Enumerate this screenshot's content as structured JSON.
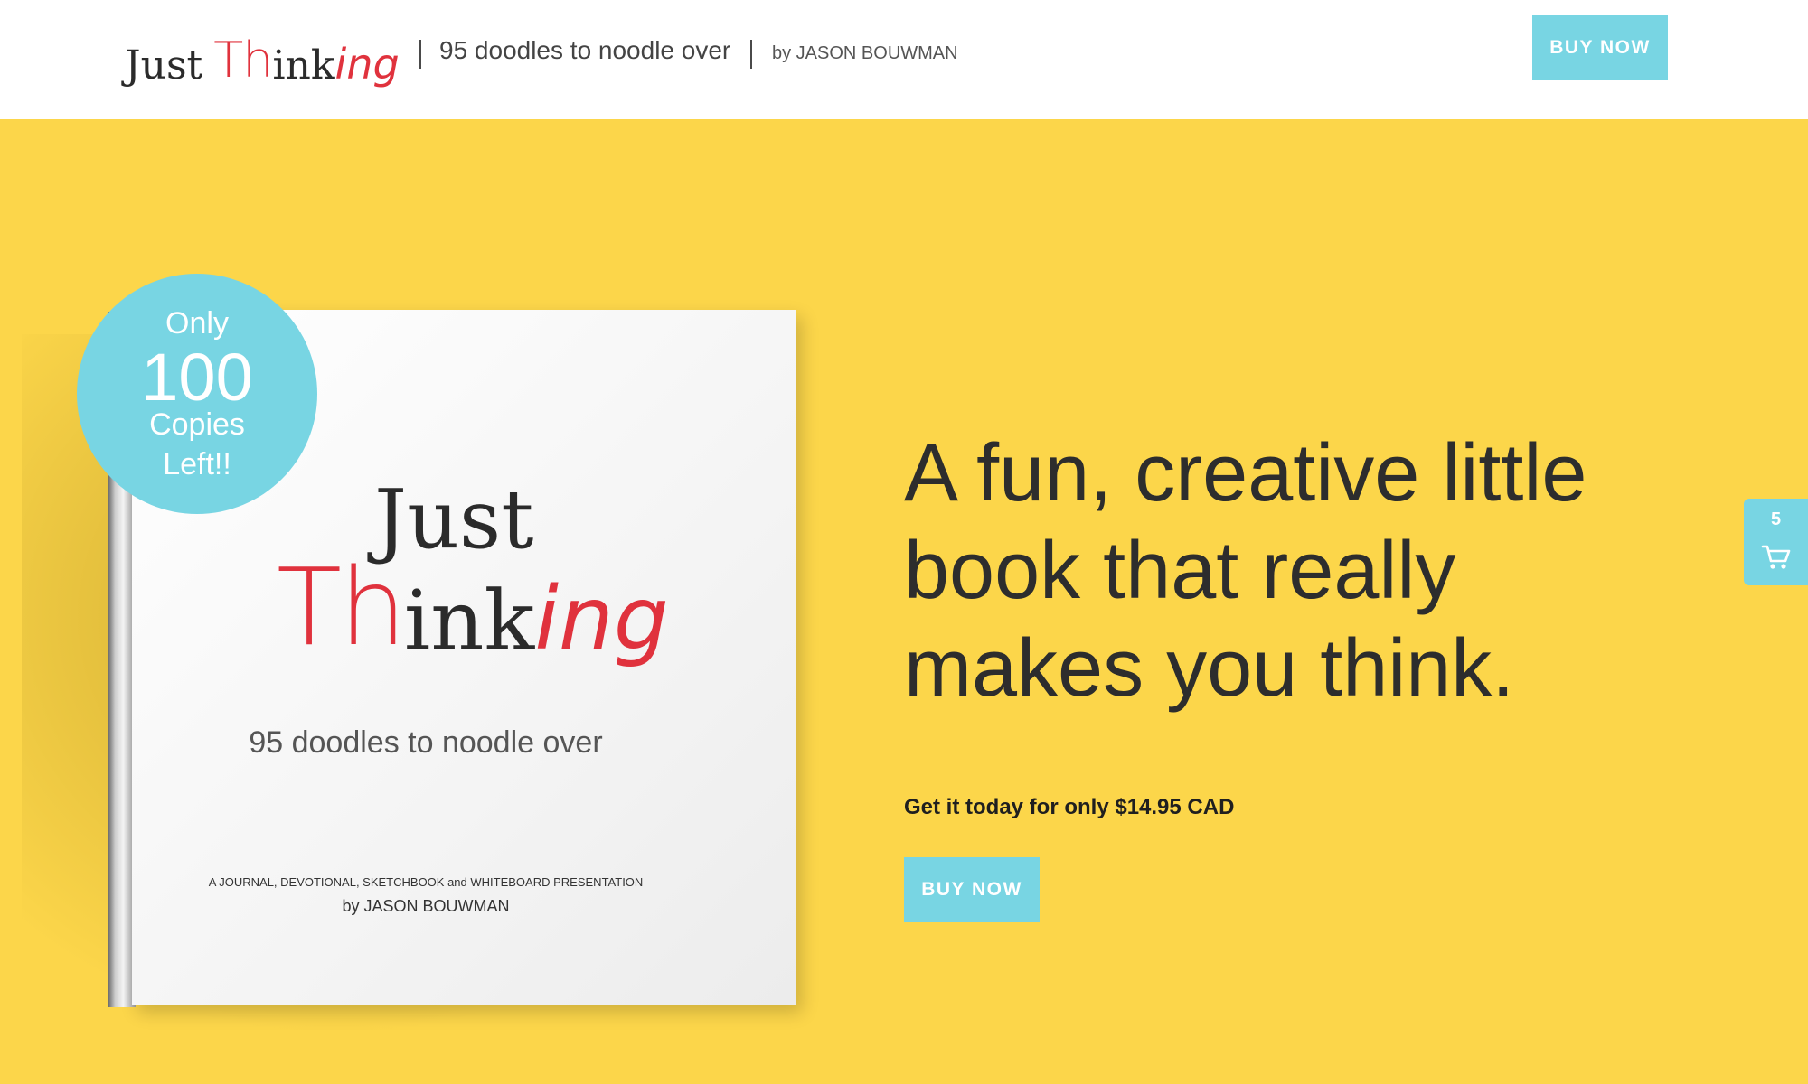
{
  "header": {
    "logo": {
      "just": "Just",
      "th": "Th",
      "ink": "ink",
      "ing": "ing"
    },
    "tagline": "95 doodles to noodle over",
    "byline": "by JASON BOUWMAN",
    "buy_label": "BUY NOW"
  },
  "book": {
    "just": "Just",
    "th": "Th",
    "ink": "ink",
    "ing": "ing",
    "subtitle": "95 doodles to noodle over",
    "description": "A JOURNAL, DEVOTIONAL, SKETCHBOOK and WHITEBOARD PRESENTATION",
    "author": "by JASON BOUWMAN"
  },
  "badge": {
    "line1": "Only",
    "number": "100",
    "line3": "Copies",
    "line4": "Left!!"
  },
  "hero": {
    "headline": "A fun, creative little book that really makes you think.",
    "price_text": "Get it today for only $14.95 CAD",
    "buy_label": "BUY NOW"
  },
  "cart": {
    "count": "5",
    "icon": "cart-icon"
  },
  "colors": {
    "background": "#fcd64a",
    "accent": "#78d5e3",
    "logo_red": "#e0323d",
    "text_dark": "#2d2d2d"
  }
}
